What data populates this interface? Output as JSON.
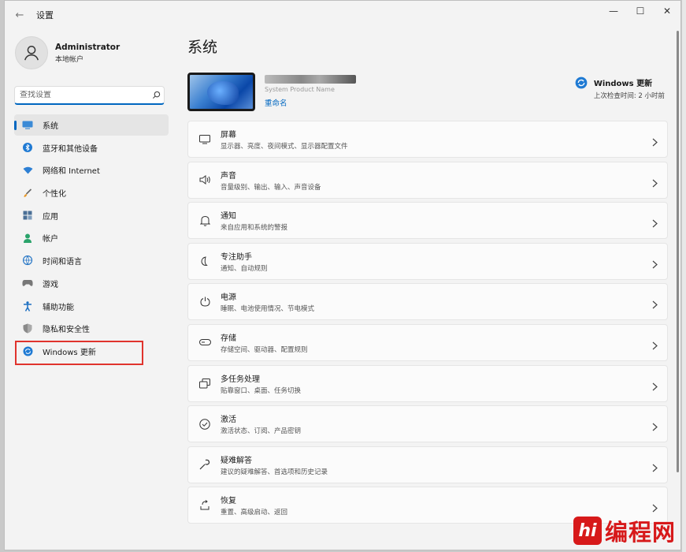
{
  "window": {
    "title": "设置"
  },
  "controls": {
    "back": "←",
    "minimize": "—",
    "maximize": "☐",
    "close": "✕"
  },
  "profile": {
    "name": "Administrator",
    "type": "本地帐户"
  },
  "search": {
    "placeholder": "查找设置"
  },
  "sidebar": {
    "items": [
      {
        "label": "系统",
        "icon": "monitor-icon"
      },
      {
        "label": "蓝牙和其他设备",
        "icon": "bluetooth-icon"
      },
      {
        "label": "网络和 Internet",
        "icon": "wifi-icon"
      },
      {
        "label": "个性化",
        "icon": "brush-icon"
      },
      {
        "label": "应用",
        "icon": "apps-icon"
      },
      {
        "label": "帐户",
        "icon": "person-icon"
      },
      {
        "label": "时间和语言",
        "icon": "globe-clock-icon"
      },
      {
        "label": "游戏",
        "icon": "gamepad-icon"
      },
      {
        "label": "辅助功能",
        "icon": "accessibility-icon"
      },
      {
        "label": "隐私和安全性",
        "icon": "shield-icon"
      },
      {
        "label": "Windows 更新",
        "icon": "update-icon"
      }
    ]
  },
  "main": {
    "title": "系统",
    "device": {
      "model": "System Product Name",
      "rename": "重命名"
    },
    "update": {
      "title": "Windows 更新",
      "subtitle": "上次检查时间: 2 小时前"
    },
    "cards": [
      {
        "label": "屏幕",
        "sub": "显示器、亮度、夜间模式、显示器配置文件",
        "icon": "display-icon"
      },
      {
        "label": "声音",
        "sub": "音量级别、输出、输入、声音设备",
        "icon": "speaker-icon"
      },
      {
        "label": "通知",
        "sub": "来自应用和系统的警报",
        "icon": "bell-icon"
      },
      {
        "label": "专注助手",
        "sub": "通知、自动规则",
        "icon": "moon-icon"
      },
      {
        "label": "电源",
        "sub": "睡眠、电池使用情况、节电模式",
        "icon": "power-icon"
      },
      {
        "label": "存储",
        "sub": "存储空间、驱动器、配置规则",
        "icon": "storage-icon"
      },
      {
        "label": "多任务处理",
        "sub": "贴靠窗口、桌面、任务切换",
        "icon": "multitask-icon"
      },
      {
        "label": "激活",
        "sub": "激活状态、订阅、产品密钥",
        "icon": "check-circle-icon"
      },
      {
        "label": "疑难解答",
        "sub": "建议的疑难解答、首选项和历史记录",
        "icon": "wrench-icon"
      },
      {
        "label": "恢复",
        "sub": "重置、高级启动、返回",
        "icon": "recovery-icon"
      }
    ]
  },
  "watermark": {
    "logo": "hi",
    "text": "编程网"
  },
  "colors": {
    "accent": "#0067c0",
    "highlight": "#e0332d",
    "watermark": "#d7191a"
  }
}
